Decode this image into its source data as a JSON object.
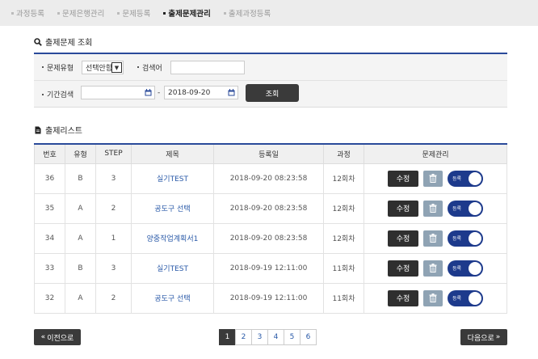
{
  "nav": {
    "items": [
      {
        "label": "과정등록",
        "active": false
      },
      {
        "label": "문제은행관리",
        "active": false
      },
      {
        "label": "문제등록",
        "active": false
      },
      {
        "label": "출제문제관리",
        "active": true
      },
      {
        "label": "출제과정등록",
        "active": false
      }
    ]
  },
  "search": {
    "title": "출제문제 조회",
    "type_label": "문제유형",
    "type_value": "선택안함",
    "keyword_label": "검색어",
    "keyword_value": "",
    "period_label": "기간검색",
    "date_from": "",
    "date_sep": "-",
    "date_to": "2018-09-20",
    "submit_label": "조회"
  },
  "list": {
    "title": "출제리스트",
    "columns": [
      "번호",
      "유형",
      "STEP",
      "제목",
      "등록일",
      "과정",
      "문제관리"
    ],
    "rows": [
      {
        "no": "36",
        "type": "B",
        "step": "3",
        "title": "실기TEST",
        "date": "2018-09-20 08:23:58",
        "course": "12회차"
      },
      {
        "no": "35",
        "type": "A",
        "step": "2",
        "title": "공도구 선택",
        "date": "2018-09-20 08:23:58",
        "course": "12회차"
      },
      {
        "no": "34",
        "type": "A",
        "step": "1",
        "title": "양중작업계획서1",
        "date": "2018-09-20 08:23:58",
        "course": "12회차"
      },
      {
        "no": "33",
        "type": "B",
        "step": "3",
        "title": "실기TEST",
        "date": "2018-09-19 12:11:00",
        "course": "11회차"
      },
      {
        "no": "32",
        "type": "A",
        "step": "2",
        "title": "공도구 선택",
        "date": "2018-09-19 12:11:00",
        "course": "11회차"
      }
    ],
    "edit_label": "수정",
    "toggle_label": "등록"
  },
  "pager": {
    "prev_label": "이전으로",
    "next_label": "다음으로",
    "pages": [
      "1",
      "2",
      "3",
      "4",
      "5",
      "6"
    ],
    "current": "1"
  },
  "colors": {
    "accent": "#2a4a9a",
    "toggle": "#1d3a8c",
    "dark_button": "#3a3a3a",
    "link": "#2a5aa8"
  }
}
